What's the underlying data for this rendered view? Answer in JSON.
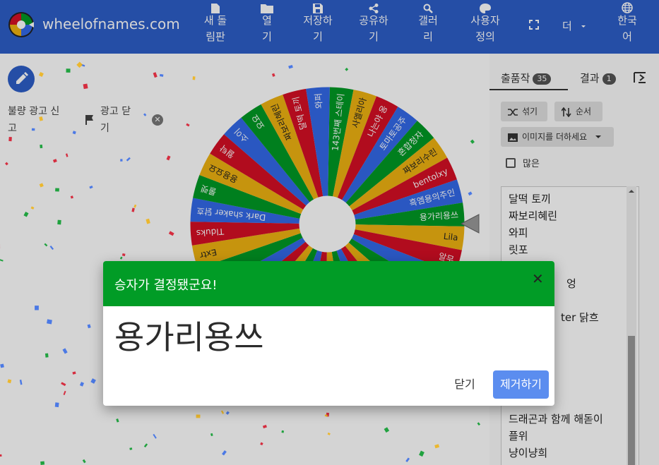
{
  "header": {
    "brand": "wheelofnames.com",
    "nav": [
      {
        "line1": "새 돌",
        "line2": "림판",
        "icon": "new-file-icon"
      },
      {
        "line1": "열",
        "line2": "기",
        "icon": "folder-icon"
      },
      {
        "line1": "저장하",
        "line2": "기",
        "icon": "save-icon"
      },
      {
        "line1": "공유하",
        "line2": "기",
        "icon": "share-icon"
      },
      {
        "line1": "갤러",
        "line2": "리",
        "icon": "search-icon"
      },
      {
        "line1": "사용자",
        "line2": "정의",
        "icon": "palette-icon"
      }
    ],
    "more": "더",
    "language": {
      "line1": "한국",
      "line2": "어"
    }
  },
  "ad": {
    "report_line1": "불량 광고 신",
    "report_line2": "고",
    "close_line1": "광고 닫",
    "close_line2": "기"
  },
  "wheel": {
    "labels": [
      "143번째 스테이",
      "사엘리아",
      "나는야 옹",
      "토마토공주",
      "혼합청자",
      "짜보리수린",
      "bentolxy",
      "흑엠용의주인",
      "용가리용쓰",
      "Lila",
      "알무",
      "",
      "",
      "",
      "",
      "",
      "",
      "",
      "",
      "",
      "",
      "",
      "",
      "",
      "",
      "Extr",
      "Tlduks",
      "Dark shaker 닭흐",
      "룰렛",
      "용용요요",
      "월탁",
      "소이",
      "요요",
      "짜보리혜린",
      "달떡 토끼",
      "와퍼"
    ],
    "colors": [
      "#009925",
      "#eeb211",
      "#d50f25",
      "#3369e8"
    ]
  },
  "panel": {
    "tabs": [
      {
        "label": "출품작",
        "count": "35"
      },
      {
        "label": "결과",
        "count": "1"
      }
    ],
    "shuffle_label": "섞기",
    "sort_label": "순서",
    "add_image_label": "이미지를 더하세요",
    "advanced_label": "많은",
    "entries": [
      "달떡 토끼",
      "짜보리혜린",
      "와피",
      "릿포",
      "",
      "",
      "",
      "드래곤과 함께 해돋이",
      "플위",
      "냥이냥희"
    ],
    "partial_entries": [
      "엉",
      "ter 닭흐"
    ]
  },
  "modal": {
    "title": "승자가 결정됐군요!",
    "winner": "용가리용쓰",
    "close_label": "닫기",
    "remove_label": "제거하기"
  }
}
